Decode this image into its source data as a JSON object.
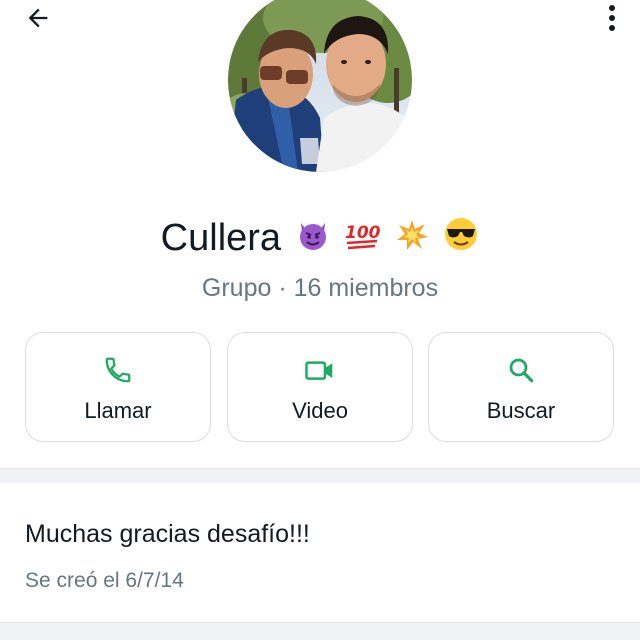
{
  "header": {
    "back_icon": "arrow-left-icon",
    "menu_icon": "more-vertical-icon"
  },
  "profile": {
    "avatar": "group-photo",
    "name": "Cullera",
    "name_emojis": [
      "smiling-devil-emoji",
      "hundred-points-emoji",
      "collision-emoji",
      "sunglasses-face-emoji"
    ],
    "subtitle": "Grupo · 16 miembros"
  },
  "actions": [
    {
      "label": "Llamar",
      "icon": "phone-icon"
    },
    {
      "label": "Video",
      "icon": "video-camera-icon"
    },
    {
      "label": "Buscar",
      "icon": "search-icon"
    }
  ],
  "description": {
    "text": "Muchas gracias desafío!!!",
    "created": "Se creó el 6/7/14"
  },
  "colors": {
    "accent": "#1daa61",
    "text_primary": "#111b21",
    "text_secondary": "#667781",
    "card_border": "#d9dee0",
    "band": "#f0f2f5"
  }
}
